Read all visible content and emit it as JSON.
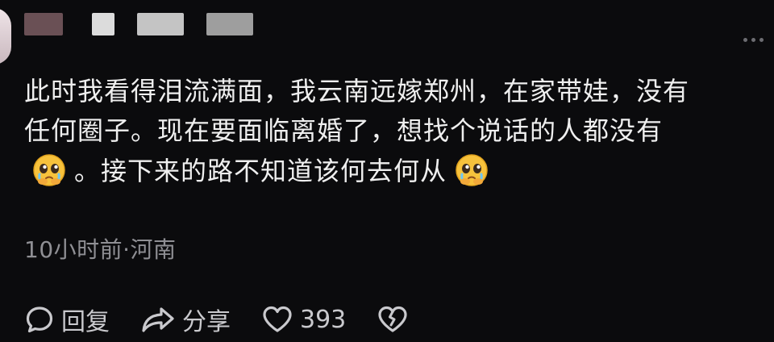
{
  "comment": {
    "line1": "此时我看得泪流满面，我云南远嫁郑州，在家带娃，没有",
    "line2": "任何圈子。现在要面临离婚了，想找个说话的人都没有",
    "line3": "。接下来的路不知道该何去何从",
    "emoji": "pleading-face-emoji"
  },
  "meta": {
    "time": "10小时前",
    "separator": "·",
    "location": "河南"
  },
  "actions": {
    "reply_label": "回复",
    "share_label": "分享",
    "like_count": "393"
  },
  "colors": {
    "background": "#0b0b0d",
    "text": "#efefef",
    "meta": "#8f8f94",
    "icon": "#c9c9cd"
  }
}
